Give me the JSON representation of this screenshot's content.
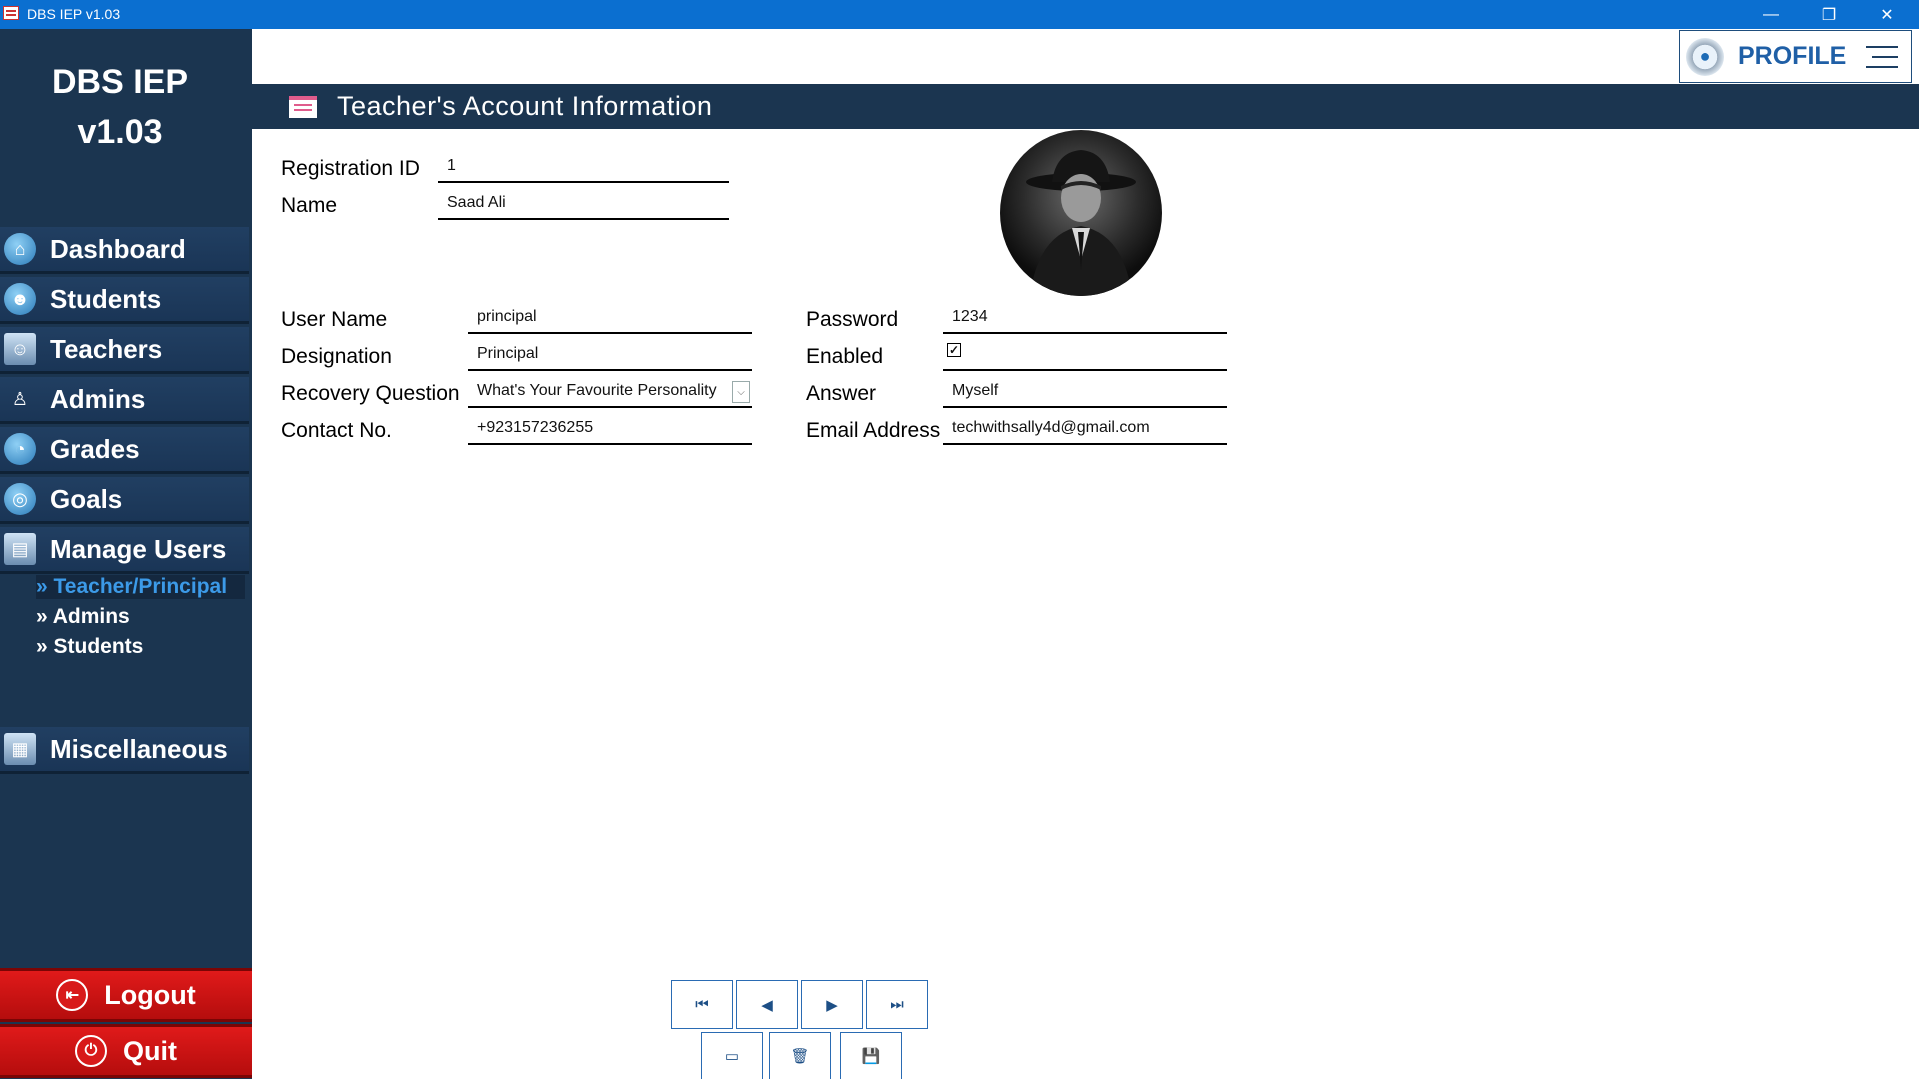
{
  "window": {
    "title": "DBS IEP v1.03",
    "controls": {
      "minimize": "—",
      "restore": "❐",
      "close": "✕"
    }
  },
  "sidebar": {
    "brand_line1": "DBS IEP",
    "brand_line2": "v1.03",
    "items": [
      {
        "label": "Dashboard",
        "icon": "home-icon"
      },
      {
        "label": "Students",
        "icon": "students-icon"
      },
      {
        "label": "Teachers",
        "icon": "teacher-icon"
      },
      {
        "label": "Admins",
        "icon": "admin-icon"
      },
      {
        "label": "Grades",
        "icon": "grades-icon"
      },
      {
        "label": "Goals",
        "icon": "target-icon"
      },
      {
        "label": "Manage Users",
        "icon": "manage-users-icon"
      }
    ],
    "subitems": [
      {
        "label": "» Teacher/Principal",
        "active": true
      },
      {
        "label": "» Admins",
        "active": false
      },
      {
        "label": "» Students",
        "active": false
      }
    ],
    "misc_label": "Miscellaneous",
    "logout_label": "Logout",
    "quit_label": "Quit"
  },
  "header": {
    "profile_label": "PROFILE"
  },
  "section": {
    "title": "Teacher's Account Information"
  },
  "form": {
    "registration_id": {
      "label": "Registration ID",
      "value": "1"
    },
    "name": {
      "label": "Name",
      "value": "Saad Ali"
    },
    "username": {
      "label": "User Name",
      "value": "principal"
    },
    "designation": {
      "label": "Designation",
      "value": "Principal"
    },
    "recovery_question": {
      "label": "Recovery Question",
      "value": "What's Your Favourite Personality"
    },
    "contact": {
      "label": "Contact No.",
      "value": "+923157236255"
    },
    "password": {
      "label": "Password",
      "value": "1234"
    },
    "enabled": {
      "label": "Enabled",
      "checked": true
    },
    "answer": {
      "label": "Answer",
      "value": "Myself"
    },
    "email": {
      "label": "Email Address",
      "value": "techwithsally4d@gmail.com"
    }
  },
  "colors": {
    "titlebar": "#0b6fd0",
    "sidebar": "#1b3550",
    "accent": "#1f5fa6",
    "danger": "#d81a1a",
    "active_sub": "#3c9ae8"
  }
}
